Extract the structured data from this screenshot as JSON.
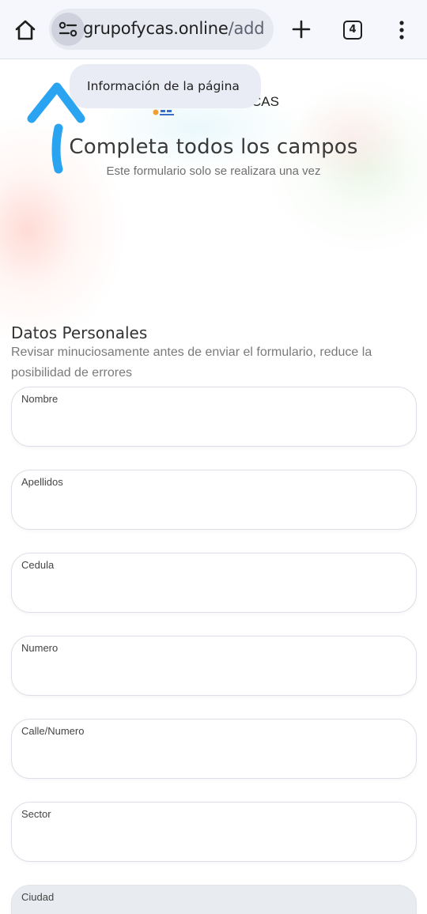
{
  "browser": {
    "url_domain": "grupofycas.online",
    "url_path": "/add",
    "tab_count": "4",
    "tooltip": "Información de la página"
  },
  "header": {
    "logo_text": "CAS",
    "title": "Completa todos los campos",
    "subtitle": "Este formulario solo se realizara una vez"
  },
  "section": {
    "title": "Datos Personales",
    "description": "Revisar minuciosamente antes de enviar el formulario, reduce la posibilidad de errores"
  },
  "fields": [
    {
      "label": "Nombre",
      "value": "",
      "disabled": false
    },
    {
      "label": "Apellidos",
      "value": "",
      "disabled": false
    },
    {
      "label": "Cedula",
      "value": "",
      "disabled": false
    },
    {
      "label": "Numero",
      "value": "",
      "disabled": false
    },
    {
      "label": "Calle/Numero",
      "value": "",
      "disabled": false
    },
    {
      "label": "Sector",
      "value": "",
      "disabled": false
    },
    {
      "label": "Ciudad",
      "value": "",
      "disabled": true
    }
  ],
  "colors": {
    "annotation": "#2aa3f0",
    "toolbar_bg": "#f6f7fc",
    "disabled_field_bg": "#e8ebef"
  }
}
